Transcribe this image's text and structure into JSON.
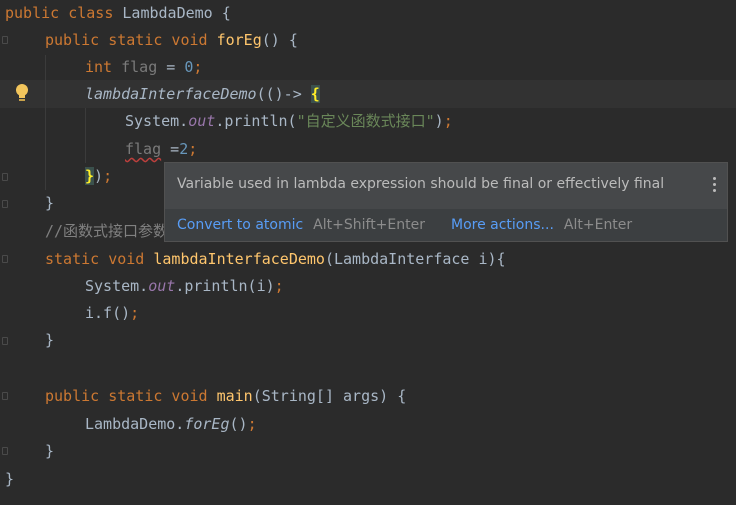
{
  "code": {
    "l1_kw": "public class",
    "l1_name": "LambdaDemo",
    "l1_brace": "{",
    "l2_kw": "public static void",
    "l2_fn": "forEg",
    "l2_rest": "() {",
    "l3_kw": "int",
    "l3_var": "flag",
    "l3_eq": " = ",
    "l3_num": "0",
    "l3_semi": ";",
    "l4_call": "lambdaInterfaceDemo",
    "l4_rest": "(()->",
    "l4_brace": "{",
    "l5_obj": "System.",
    "l5_field": "out",
    "l5_method": ".println(",
    "l5_str": "\"自定义函数式接口\"",
    "l5_close": ")",
    "l5_semi": ";",
    "l6_var": "flag",
    "l6_eq": " =",
    "l6_num": "2",
    "l6_semi": ";",
    "l7_brace": "}",
    "l7_close": ")",
    "l7_semi": ";",
    "l8_brace": "}",
    "l9_comment": "//函数式接口参数",
    "l10_kw": "static void",
    "l10_fn": "lambdaInterfaceDemo",
    "l10_rest": "(LambdaInterface i){",
    "l11_obj": "System.",
    "l11_field": "out",
    "l11_method": ".println(i)",
    "l11_semi": ";",
    "l12_call": "i.f()",
    "l12_semi": ";",
    "l13_brace": "}",
    "l15_kw": "public static void",
    "l15_fn": "main",
    "l15_rest": "(String[] args) {",
    "l16_obj": "LambdaDemo.",
    "l16_call": "forEg",
    "l16_rest": "()",
    "l16_semi": ";",
    "l17_brace": "}",
    "l18_brace": "}"
  },
  "popup": {
    "message": "Variable used in lambda expression should be final or effectively final",
    "action_primary": "Convert to atomic",
    "action_primary_shortcut": "Alt+Shift+Enter",
    "action_more": "More actions...",
    "action_more_shortcut": "Alt+Enter"
  },
  "colors": {
    "background": "#2b2b2b",
    "keyword": "#cc7832",
    "function": "#ffc66d",
    "number": "#6897bb",
    "string": "#6a8759",
    "link": "#589df6"
  }
}
